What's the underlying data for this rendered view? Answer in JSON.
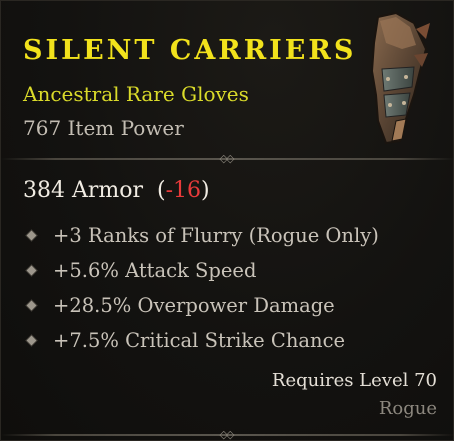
{
  "item": {
    "name": "SILENT CARRIERS",
    "type_line": "Ancestral Rare Gloves",
    "item_power": "767 Item Power",
    "armor": {
      "value_text": "384 Armor",
      "delta_open": "(",
      "delta": "-16",
      "delta_close": ")"
    },
    "affixes": [
      "+3 Ranks of Flurry (Rogue Only)",
      "+5.6% Attack Speed",
      "+28.5% Overpower Damage",
      "+7.5% Critical Strike Chance"
    ],
    "requirement": "Requires Level 70",
    "class": "Rogue",
    "icon": "leather-gloves-icon"
  },
  "colors": {
    "rare_yellow": "#f2e21c",
    "negative_red": "#e83a3a",
    "text_light": "#c9c3b9"
  }
}
